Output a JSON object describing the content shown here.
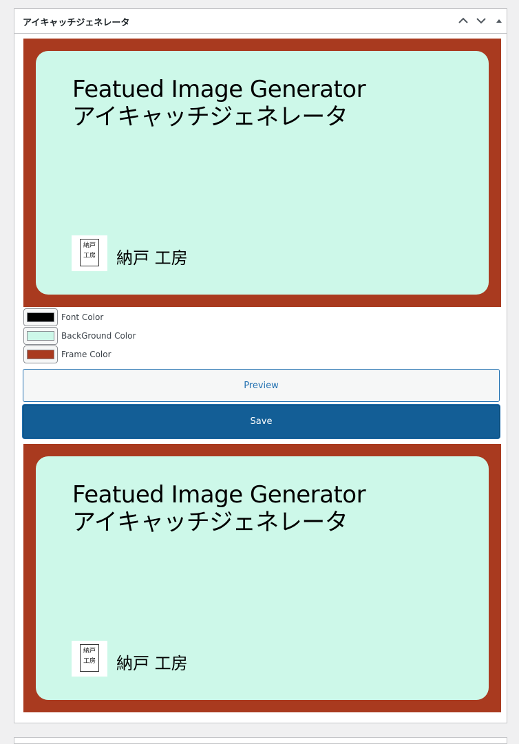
{
  "panel": {
    "title": "アイキャッチジェネレータ",
    "controls": [
      "move-up",
      "move-down",
      "toggle-collapse"
    ]
  },
  "card": {
    "title_line1": "Featued Image Generator",
    "title_line2": "アイキャッチジェネレータ",
    "author": "納戸 工房",
    "logo_text_top": "納戸",
    "logo_text_bottom": "工房"
  },
  "colors": [
    {
      "label": "Font Color",
      "value": "#000000"
    },
    {
      "label": "BackGround Color",
      "value": "#cdf8e9"
    },
    {
      "label": "Frame Color",
      "value": "#a93a1f"
    }
  ],
  "buttons": {
    "preview": "Preview",
    "save": "Save"
  }
}
